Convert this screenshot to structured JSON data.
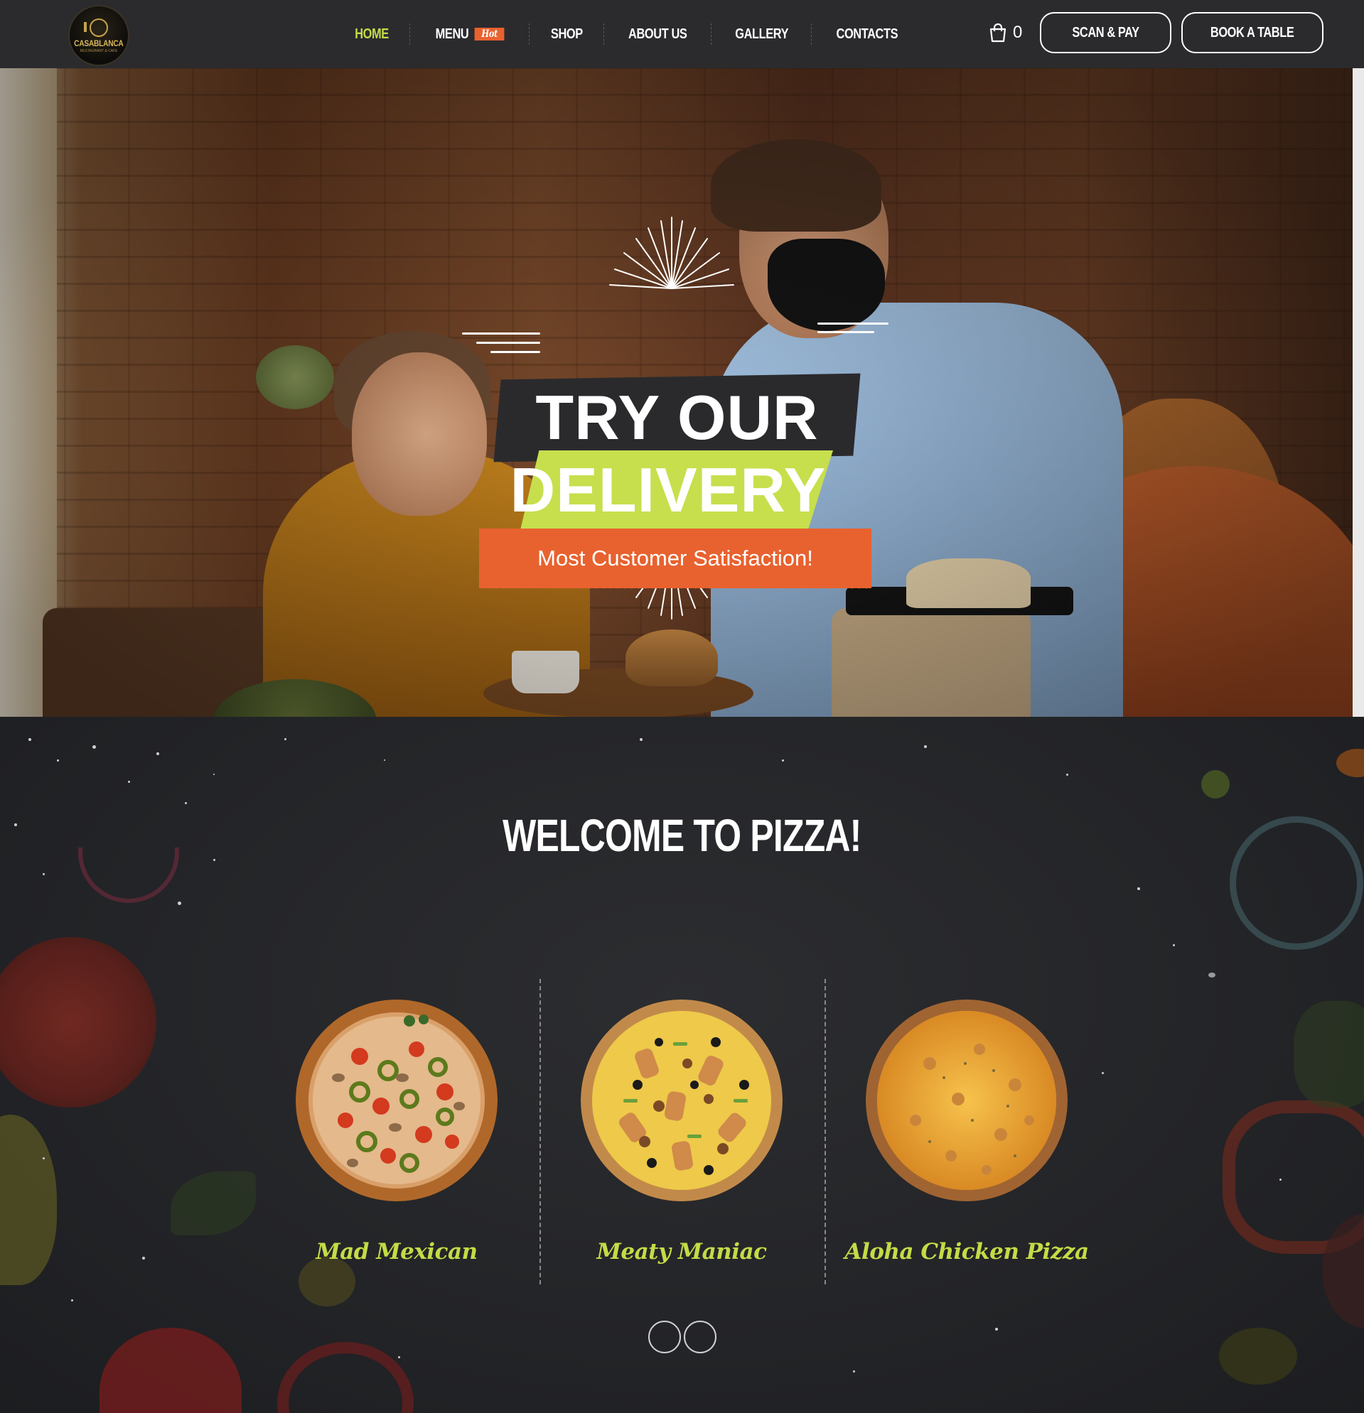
{
  "header": {
    "logo_text": "CASABLANCA",
    "logo_sub": "RESTAURANT & CAFE",
    "nav": [
      {
        "label": "HOME",
        "active": true
      },
      {
        "label": "MENU",
        "badge": "Hot"
      },
      {
        "label": "SHOP"
      },
      {
        "label": "ABOUT US"
      },
      {
        "label": "GALLERY"
      },
      {
        "label": "CONTACTS"
      }
    ],
    "cart_count": "0",
    "scan_pay_label": "SCAN & PAY",
    "book_label": "BOOK A TABLE"
  },
  "hero": {
    "line1": "TRY OUR",
    "line2": "DELIVERY",
    "subtitle": "Most Customer Satisfaction!",
    "slide_count": 5
  },
  "welcome": {
    "title": "WELCOME TO PIZZA!",
    "pizzas": [
      {
        "name": "Mad Mexican"
      },
      {
        "name": "Meaty Maniac"
      },
      {
        "name": "Aloha Chicken Pizza"
      }
    ]
  },
  "colors": {
    "accent_green": "#c5db46",
    "accent_orange": "#e8622f",
    "dark": "#2b2b2e"
  },
  "icons": {
    "cart": "shopping-bag-icon",
    "next": "chevron-right-icon",
    "pause": "pause-icon"
  }
}
